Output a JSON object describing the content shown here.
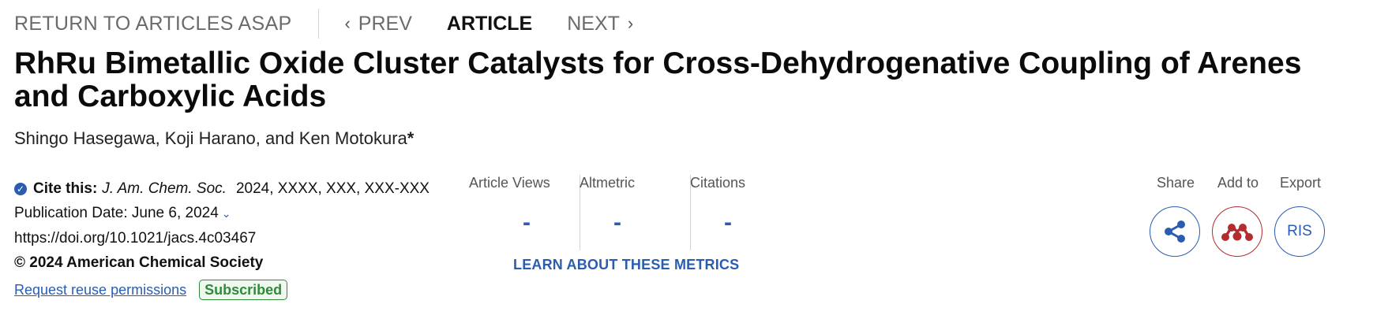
{
  "nav": {
    "return_label": "RETURN TO ARTICLES ASAP",
    "prev_label": "PREV",
    "article_label": "ARTICLE",
    "next_label": "NEXT"
  },
  "article": {
    "title": "RhRu Bimetallic Oxide Cluster Catalysts for Cross-Dehydrogenative Coupling of Arenes and Carboxylic Acids",
    "authors": "Shingo Hasegawa, Koji Harano, and Ken Motokura",
    "corresponding_mark": "*"
  },
  "citation": {
    "cite_label": "Cite this:",
    "journal": "J. Am. Chem. Soc.",
    "details": "2024, XXXX, XXX, XXX-XXX",
    "pub_date": "Publication Date: June 6, 2024",
    "doi": "https://doi.org/10.1021/jacs.4c03467",
    "copyright": "© 2024 American Chemical Society",
    "reuse_link": "Request reuse permissions",
    "access_badge": "Subscribed"
  },
  "metrics": {
    "items": [
      {
        "label": "Article Views",
        "value": "-"
      },
      {
        "label": "Altmetric",
        "value": "-"
      },
      {
        "label": "Citations",
        "value": "-"
      }
    ],
    "learn_link": "LEARN ABOUT THESE METRICS"
  },
  "actions": {
    "share_label": "Share",
    "add_label": "Add to",
    "export_label": "Export",
    "ris_label": "RIS"
  },
  "colors": {
    "link_blue": "#2a5db0",
    "subscribed_green": "#2f8a3a",
    "mendeley_red": "#b22e2e"
  },
  "icons": {
    "cite": "check-circle-icon",
    "share": "share-icon",
    "add_to": "mendeley-icon"
  }
}
